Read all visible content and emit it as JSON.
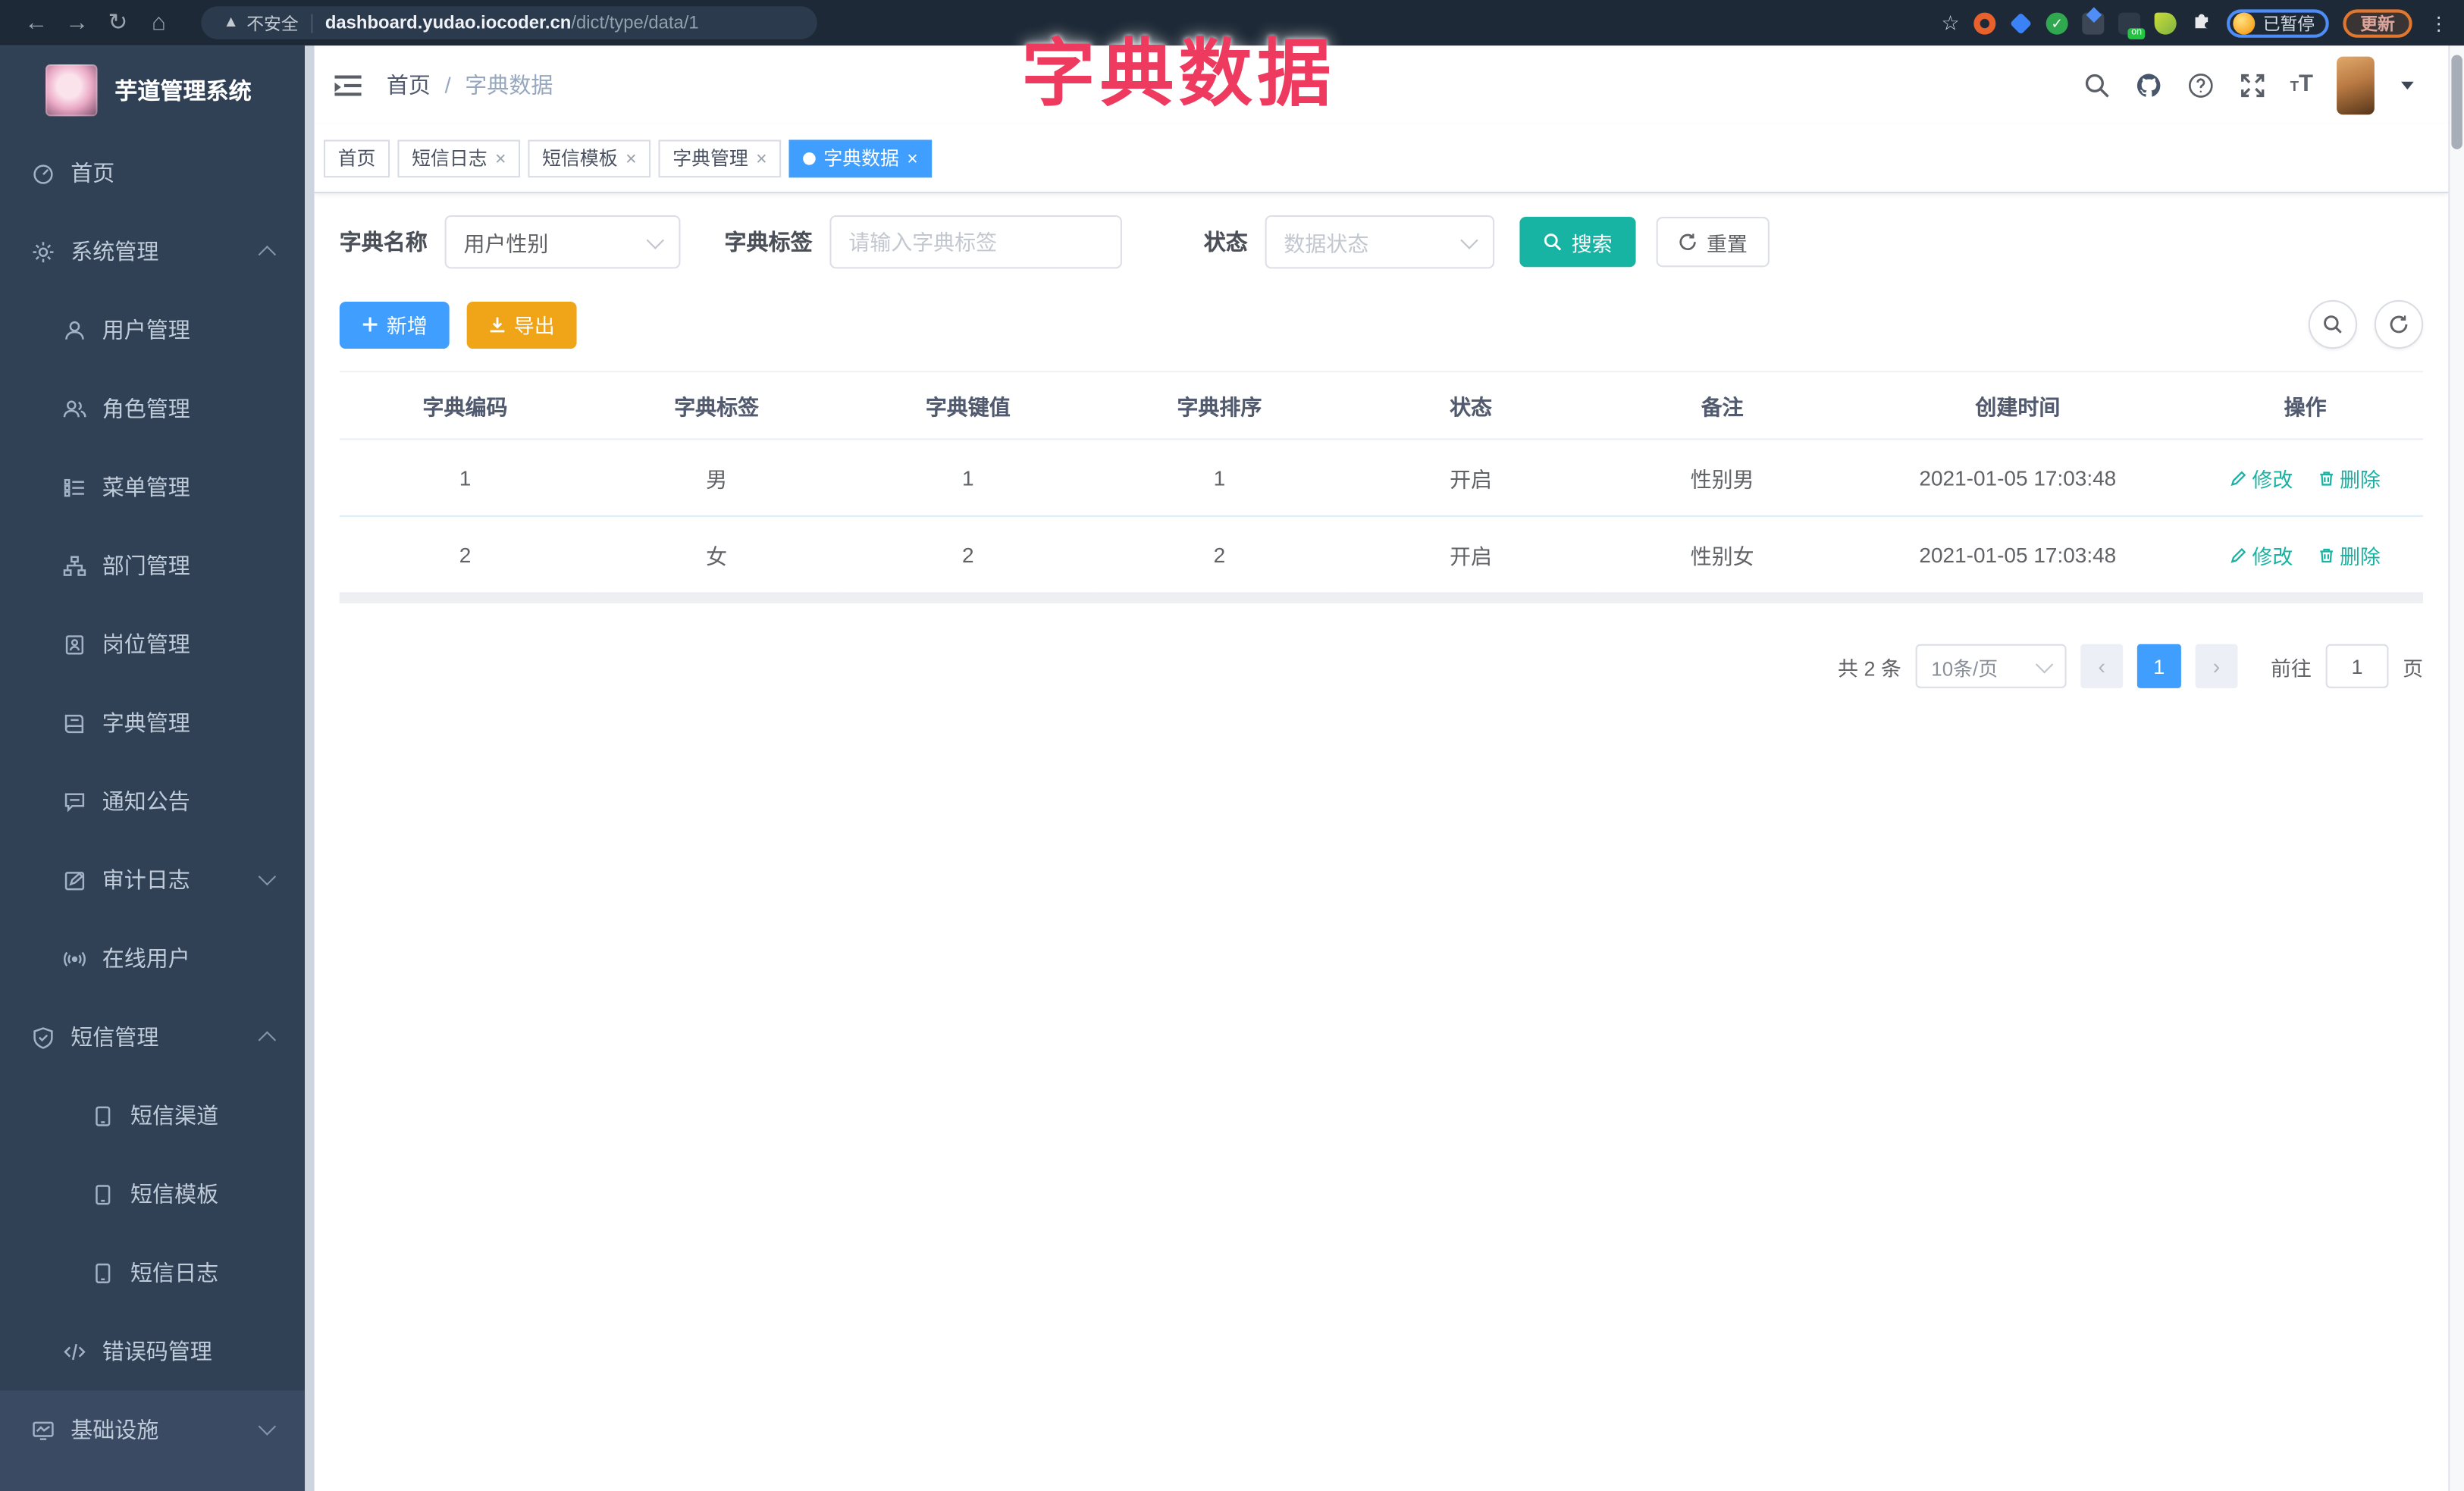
{
  "browser": {
    "security": "不安全",
    "url_domain": "dashboard.yudao.iocoder.cn",
    "url_path": "/dict/type/data/1",
    "ext_on_badge": "on",
    "paused_badge": "已暂停",
    "update_button": "更新"
  },
  "overlay_title": "字典数据",
  "sidebar": {
    "title": "芋道管理系统",
    "items": [
      {
        "label": "首页"
      },
      {
        "label": "系统管理"
      },
      {
        "label": "用户管理"
      },
      {
        "label": "角色管理"
      },
      {
        "label": "菜单管理"
      },
      {
        "label": "部门管理"
      },
      {
        "label": "岗位管理"
      },
      {
        "label": "字典管理"
      },
      {
        "label": "通知公告"
      },
      {
        "label": "审计日志"
      },
      {
        "label": "在线用户"
      },
      {
        "label": "短信管理"
      },
      {
        "label": "短信渠道"
      },
      {
        "label": "短信模板"
      },
      {
        "label": "短信日志"
      },
      {
        "label": "错误码管理"
      },
      {
        "label": "基础设施"
      }
    ]
  },
  "breadcrumb": {
    "home": "首页",
    "separator": "/",
    "current": "字典数据"
  },
  "tabs": [
    {
      "label": "首页"
    },
    {
      "label": "短信日志"
    },
    {
      "label": "短信模板"
    },
    {
      "label": "字典管理"
    },
    {
      "label": "字典数据"
    }
  ],
  "filters": {
    "dict_name_label": "字典名称",
    "dict_name_value": "用户性别",
    "dict_tag_label": "字典标签",
    "dict_tag_placeholder": "请输入字典标签",
    "status_label": "状态",
    "status_placeholder": "数据状态",
    "search_button": "搜索",
    "reset_button": "重置"
  },
  "toolbar": {
    "add_button": "新增",
    "export_button": "导出"
  },
  "table": {
    "headers": [
      "字典编码",
      "字典标签",
      "字典键值",
      "字典排序",
      "状态",
      "备注",
      "创建时间",
      "操作"
    ],
    "rows": [
      {
        "code": "1",
        "label": "男",
        "value": "1",
        "sort": "1",
        "status": "开启",
        "remark": "性别男",
        "created": "2021-01-05 17:03:48"
      },
      {
        "code": "2",
        "label": "女",
        "value": "2",
        "sort": "2",
        "status": "开启",
        "remark": "性别女",
        "created": "2021-01-05 17:03:48"
      }
    ],
    "edit_action": "修改",
    "delete_action": "删除"
  },
  "pagination": {
    "total": "共 2 条",
    "page_size": "10条/页",
    "page": "1",
    "goto_label": "前往",
    "goto_value": "1",
    "page_unit": "页"
  },
  "colors": {
    "primary": "#409EFF",
    "success_teal": "#17b3a3",
    "warning": "#f0a519",
    "title_red": "#ee3a5f",
    "sidebar_bg": "#304156"
  }
}
